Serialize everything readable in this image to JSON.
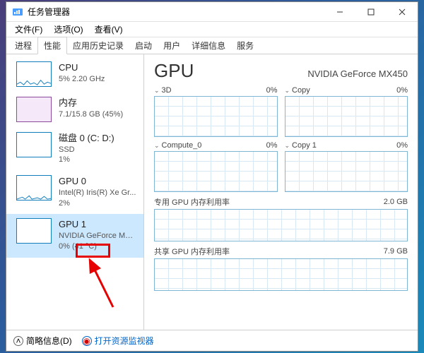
{
  "window": {
    "title": "任务管理器"
  },
  "menu": {
    "file": "文件(F)",
    "options": "选项(O)",
    "view": "查看(V)"
  },
  "tabs": {
    "proc": "进程",
    "perf": "性能",
    "hist": "应用历史记录",
    "startup": "启动",
    "users": "用户",
    "details": "详细信息",
    "services": "服务"
  },
  "sidebar": [
    {
      "title": "CPU",
      "sub": "5%  2.20 GHz",
      "val": ""
    },
    {
      "title": "内存",
      "sub": "7.1/15.8 GB (45%)",
      "val": ""
    },
    {
      "title": "磁盘 0 (C: D:)",
      "sub": "SSD",
      "val": "1%"
    },
    {
      "title": "GPU 0",
      "sub": "Intel(R) Iris(R) Xe Gr...",
      "val": "2%"
    },
    {
      "title": "GPU 1",
      "sub": "NVIDIA GeForce MX...",
      "val": "0% (41 °C)"
    }
  ],
  "main": {
    "title": "GPU",
    "name": "NVIDIA GeForce MX450",
    "charts": [
      {
        "label": "3D",
        "value": "0%"
      },
      {
        "label": "Copy",
        "value": "0%"
      },
      {
        "label": "Compute_0",
        "value": "0%"
      },
      {
        "label": "Copy 1",
        "value": "0%"
      }
    ],
    "full": [
      {
        "label": "专用 GPU 内存利用率",
        "value": "2.0 GB"
      },
      {
        "label": "共享 GPU 内存利用率",
        "value": "7.9 GB"
      }
    ]
  },
  "bottom": {
    "brief": "简略信息(D)",
    "open": "打开资源监视器"
  }
}
